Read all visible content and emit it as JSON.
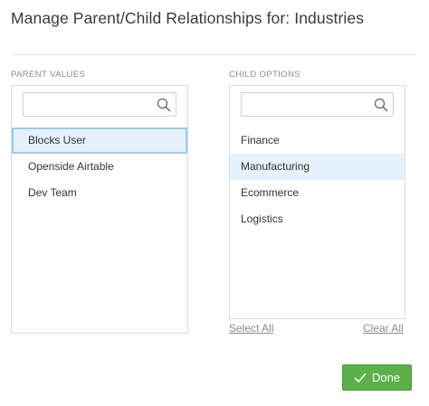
{
  "dialog": {
    "title": "Manage Parent/Child Relationships for: Industries"
  },
  "parent": {
    "label": "PARENT VALUES",
    "search_placeholder": "",
    "items": [
      {
        "label": "Blocks User",
        "state": "selected"
      },
      {
        "label": "Openside Airtable",
        "state": "normal"
      },
      {
        "label": "Dev Team",
        "state": "normal"
      }
    ]
  },
  "child": {
    "label": "CHILD OPTIONS",
    "search_placeholder": "",
    "items": [
      {
        "label": "Finance",
        "state": "normal"
      },
      {
        "label": "Manufacturing",
        "state": "highlighted"
      },
      {
        "label": "Ecommerce",
        "state": "normal"
      },
      {
        "label": "Logistics",
        "state": "normal"
      }
    ],
    "select_all_label": "Select All",
    "clear_all_label": "Clear All"
  },
  "actions": {
    "done_label": "Done"
  },
  "colors": {
    "accent": "#5cb04a",
    "selected_bg": "#e5f1fb",
    "selected_border": "#9ccbea"
  },
  "icons": {
    "search": "search-icon",
    "done": "check-icon"
  }
}
